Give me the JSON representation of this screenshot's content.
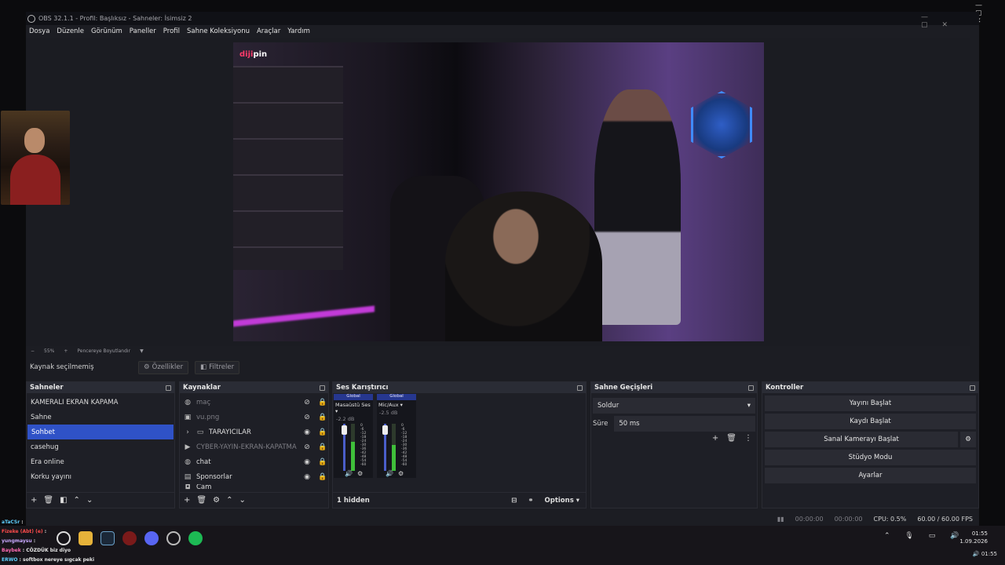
{
  "window": {
    "title": "OBS 32.1.1 - Profil: Başlıksız - Sahneler: İsimsiz 2"
  },
  "menu": [
    "Dosya",
    "Düzenle",
    "Görünüm",
    "Paneller",
    "Profil",
    "Sahne Koleksiyonu",
    "Araçlar",
    "Yardım"
  ],
  "preview": {
    "watermark_left": "diji",
    "watermark_right": "pin",
    "zoom": "55%",
    "fit_label": "Pencereye Boyutlandır"
  },
  "source_bar": {
    "label": "Kaynak seçilmemiş",
    "properties": "Özellikler",
    "filters": "Filtreler"
  },
  "scenes": {
    "title": "Sahneler",
    "items": [
      "KAMERALI EKRAN KAPAMA",
      "Sahne",
      "Sohbet",
      "casehug",
      "Era online",
      "Korku yayını"
    ],
    "selected": "Sohbet"
  },
  "sources": {
    "title": "Kaynaklar",
    "items": [
      {
        "name": "maç",
        "icon": "globe-icon",
        "dim": true
      },
      {
        "name": "vu.png",
        "icon": "image-icon",
        "dim": true
      },
      {
        "name": "TARAYICILAR",
        "icon": "folder-icon",
        "dim": false
      },
      {
        "name": "CYBER-YAYIN-EKRAN-KAPATMA.m",
        "icon": "play-icon",
        "dim": true
      },
      {
        "name": "chat",
        "icon": "globe-icon",
        "dim": false
      },
      {
        "name": "Sponsorlar",
        "icon": "monitor-icon",
        "dim": false
      },
      {
        "name": "Cam",
        "icon": "camera-icon",
        "dim": false
      }
    ]
  },
  "mixer": {
    "title": "Ses Karıştırıcı",
    "footer_hidden": "1 hidden",
    "options": "Options",
    "scale": [
      "0",
      "-6",
      "-12",
      "-18",
      "-24",
      "-30",
      "-36",
      "-42",
      "-48",
      "-54",
      "-60"
    ],
    "channels": [
      {
        "global": "Global",
        "name": "Masaüstü Ses",
        "db": "-2.2 dB",
        "level": 0.62
      },
      {
        "global": "Global",
        "name": "Mic/Aux",
        "db": "-2.5 dB",
        "level": 0.55
      }
    ]
  },
  "transitions": {
    "title": "Sahne Geçişleri",
    "type": "Soldur",
    "duration_label": "Süre",
    "duration": "50 ms"
  },
  "controls": {
    "title": "Kontroller",
    "buttons": [
      "Yayını Başlat",
      "Kaydı Başlat",
      "Sanal Kamerayı Başlat",
      "Stüdyo Modu",
      "Ayarlar"
    ]
  },
  "status": {
    "time1": "00:00:00",
    "time2": "00:00:00",
    "cpu": "CPU: 0.5%",
    "fps": "60.00 / 60.00 FPS"
  },
  "chat_overlay": [
    {
      "user": "aTaCSr",
      "msg": ""
    },
    {
      "user": "Fizeke (Abt) (e)",
      "msg": ""
    },
    {
      "user": "yungmaysu",
      "msg": ""
    },
    {
      "user": "Baybek",
      "msg": "CÖZDÜK biz diyo"
    },
    {
      "user": "ERWO",
      "msg": "softbox nereye sıgcak peki"
    }
  ],
  "tray": {
    "time": "01:55",
    "date": "1.09.2026",
    "time2": "01:55"
  }
}
